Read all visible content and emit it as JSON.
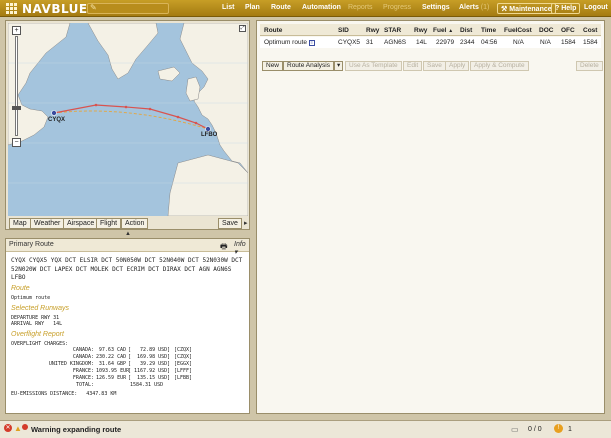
{
  "app": {
    "logo": "NAVBLUE",
    "logo_part1": "NAV",
    "logo_part2": "BLUE"
  },
  "nav": {
    "items": [
      "List",
      "Plan",
      "Route",
      "Automation",
      "Reports",
      "Progress",
      "Settings"
    ],
    "alerts_label": "Alerts",
    "alerts_count": "(1)",
    "maintenance": "Maintenance",
    "help": "Help",
    "logout": "Logout"
  },
  "map": {
    "origin": "CYQX",
    "destination": "LFBO",
    "tools": [
      "Map",
      "Weather",
      "Airspace",
      "Flight",
      "Action"
    ],
    "save": "Save"
  },
  "primary": {
    "title": "Primary Route",
    "info": "Info",
    "route_string": "CYQX CYQX5 YQX DCT ELSIR DCT 50N050W DCT 52N040W DCT 52N030W DCT 52N020W DCT LAPEX DCT MOLEK DCT ECRIM DCT DIRAX DCT AGN AGN6S LFBO",
    "route_heading": "Route",
    "route_name": "Optimum route",
    "runways_heading": "Selected Runways",
    "departure_rwy": "DEPARTURE RWY 31",
    "arrival_rwy": "ARRIVAL RWY   14L",
    "overflight_heading": "Overflight Report",
    "overflight_title": "OVERFLIGHT CHARGES:",
    "charges": [
      {
        "country": "CANADA:",
        "amount": "97.63 CAD",
        "usd": "[   72.89 USD]",
        "code": "[CZQX]"
      },
      {
        "country": "CANADA:",
        "amount": "230.22 CAD",
        "usd": "[  169.98 USD]",
        "code": "[CZQX]"
      },
      {
        "country": "UNITED KINGDOM:",
        "amount": "31.64 GBP",
        "usd": "[   39.29 USD]",
        "code": "[EGGX]"
      },
      {
        "country": "FRANCE:",
        "amount": "1093.95 EUR",
        "usd": "[ 1167.92 USD]",
        "code": "[LFFF]"
      },
      {
        "country": "FRANCE:",
        "amount": "126.59 EUR",
        "usd": "[  135.15 USD]",
        "code": "[LFBB]"
      }
    ],
    "total_label": "TOTAL:",
    "total_value": "1584.31 USD",
    "emissions": "EU-EMISSIONS DISTANCE:   4347.83 KM"
  },
  "route_table": {
    "headers": [
      "Route",
      "SID",
      "Rwy",
      "STAR",
      "Rwy",
      "Fuel",
      "Dist",
      "Time",
      "FuelCost",
      "DOC",
      "OFC",
      "Cost"
    ],
    "sort_arrow": "▲",
    "row": {
      "route": "Optimum route",
      "sid": "CYQX5",
      "rwy1": "31",
      "star": "AGN6S",
      "rwy2": "14L",
      "fuel": "22979",
      "dist": "2344",
      "time": "04:56",
      "fuelcost": "N/A",
      "doc": "N/A",
      "ofc": "1584",
      "cost": "1584"
    },
    "buttons": [
      "New",
      "Route Analysis",
      "Use As Template",
      "Edit",
      "Save",
      "Apply",
      "Apply & Compute",
      "Delete"
    ]
  },
  "status": {
    "warning": "Warning expanding route",
    "counter": "0 / 0",
    "alerts": "1"
  },
  "colors": {
    "accent": "#b88d1c",
    "route_red": "#d9534f",
    "route_dash": "#e0a84a"
  }
}
